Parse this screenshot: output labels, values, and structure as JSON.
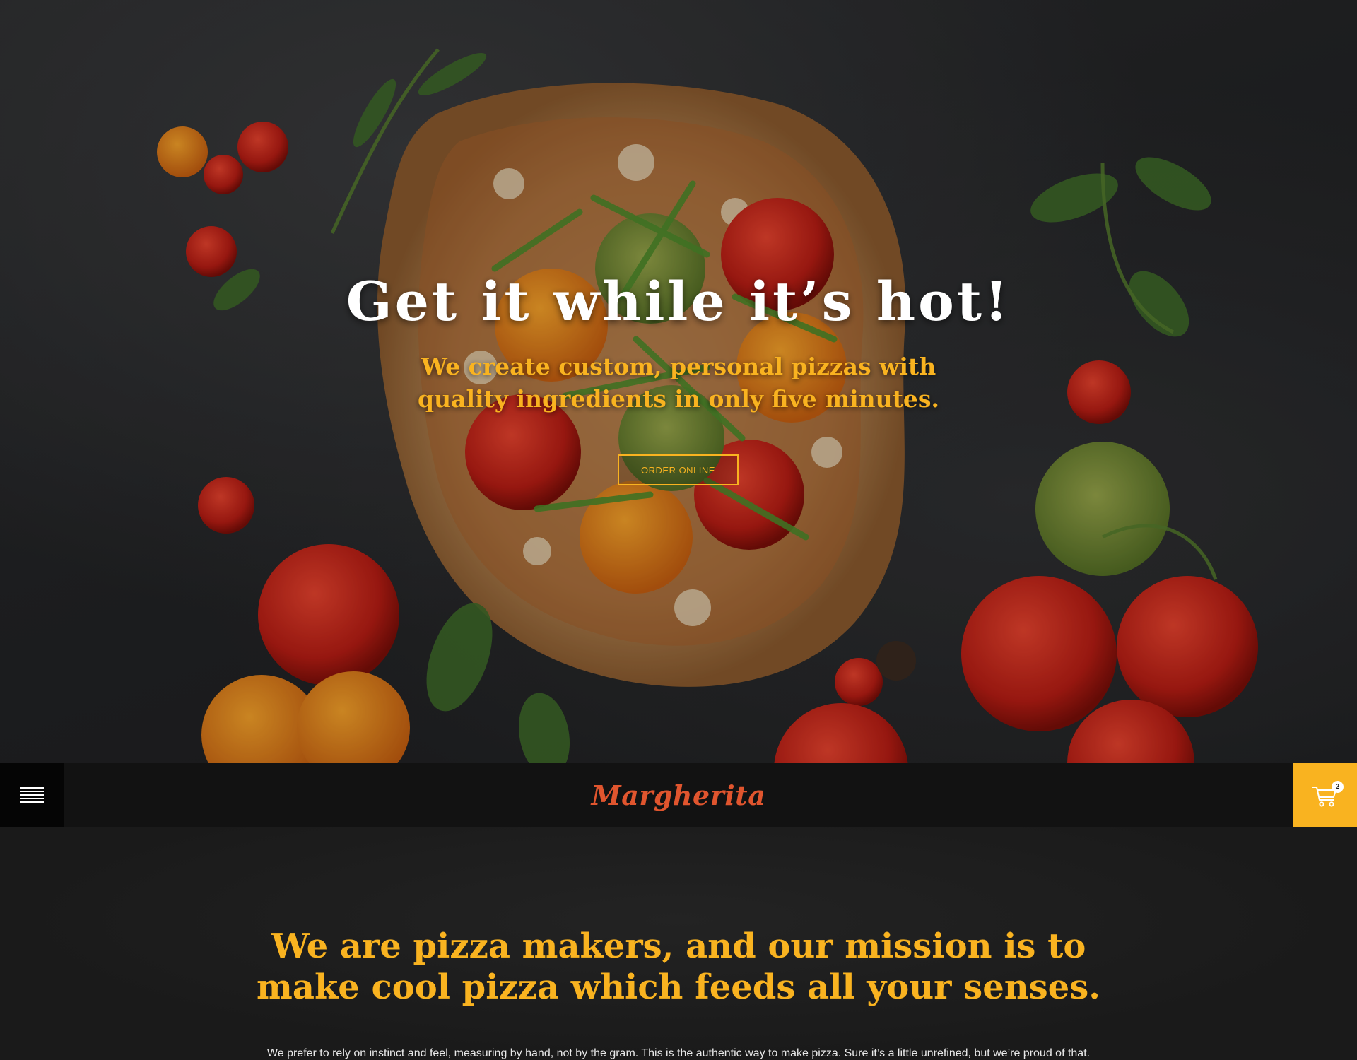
{
  "hero": {
    "title": "Get it while it’s hot!",
    "subtitle": "We create custom, personal pizzas with quality ingredients in only five minutes.",
    "cta_label": "ORDER ONLINE"
  },
  "navbar": {
    "menu_icon": "hamburger-menu-icon",
    "logo_text": "Margherita",
    "cart_icon": "shopping-cart-icon",
    "cart_count": "2"
  },
  "about": {
    "heading": "We are pizza makers, and our mission is to make cool pizza which feeds all your senses.",
    "body": "We prefer to rely on instinct and feel, measuring by hand, not by the gram. This is the authentic way to make pizza. Sure it’s a little unrefined, but we’re proud of that."
  },
  "colors": {
    "accent": "#f9b320",
    "logo": "#e0552e",
    "dark": "#121212"
  }
}
